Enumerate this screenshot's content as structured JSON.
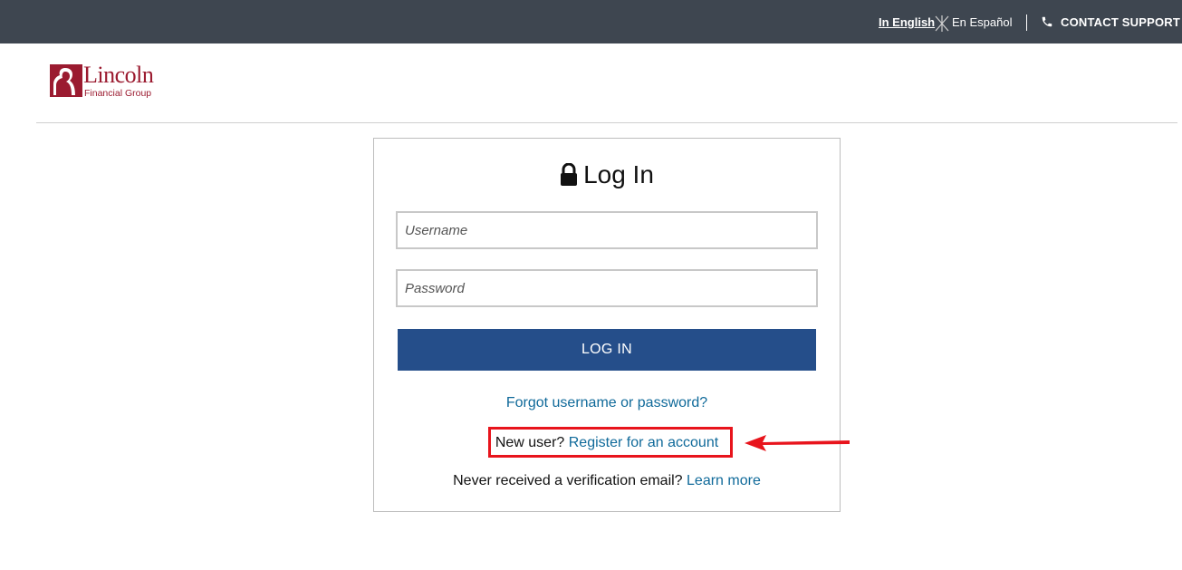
{
  "topbar": {
    "lang_english": "In English",
    "lang_spanish": "En Español",
    "contact_support": "CONTACT SUPPORT"
  },
  "logo": {
    "name": "Lincoln",
    "subtitle": "Financial Group"
  },
  "login": {
    "title": "Log In",
    "username_placeholder": "Username",
    "password_placeholder": "Password",
    "button_label": "LOG IN",
    "forgot_link": "Forgot username or password?",
    "new_user_text": "New user?",
    "register_link": "Register for an account",
    "verify_text": "Never received a verification email?",
    "learn_more_link": "Learn more"
  },
  "colors": {
    "topbar_bg": "#3e4650",
    "brand_red": "#9b1b30",
    "button_blue": "#254e8a",
    "link_blue": "#106a9a",
    "annotation_red": "#e8141c"
  },
  "icons": [
    "lock-icon",
    "phone-icon",
    "lincoln-logo-mark",
    "language-toggle-icon",
    "arrow-annotation"
  ]
}
